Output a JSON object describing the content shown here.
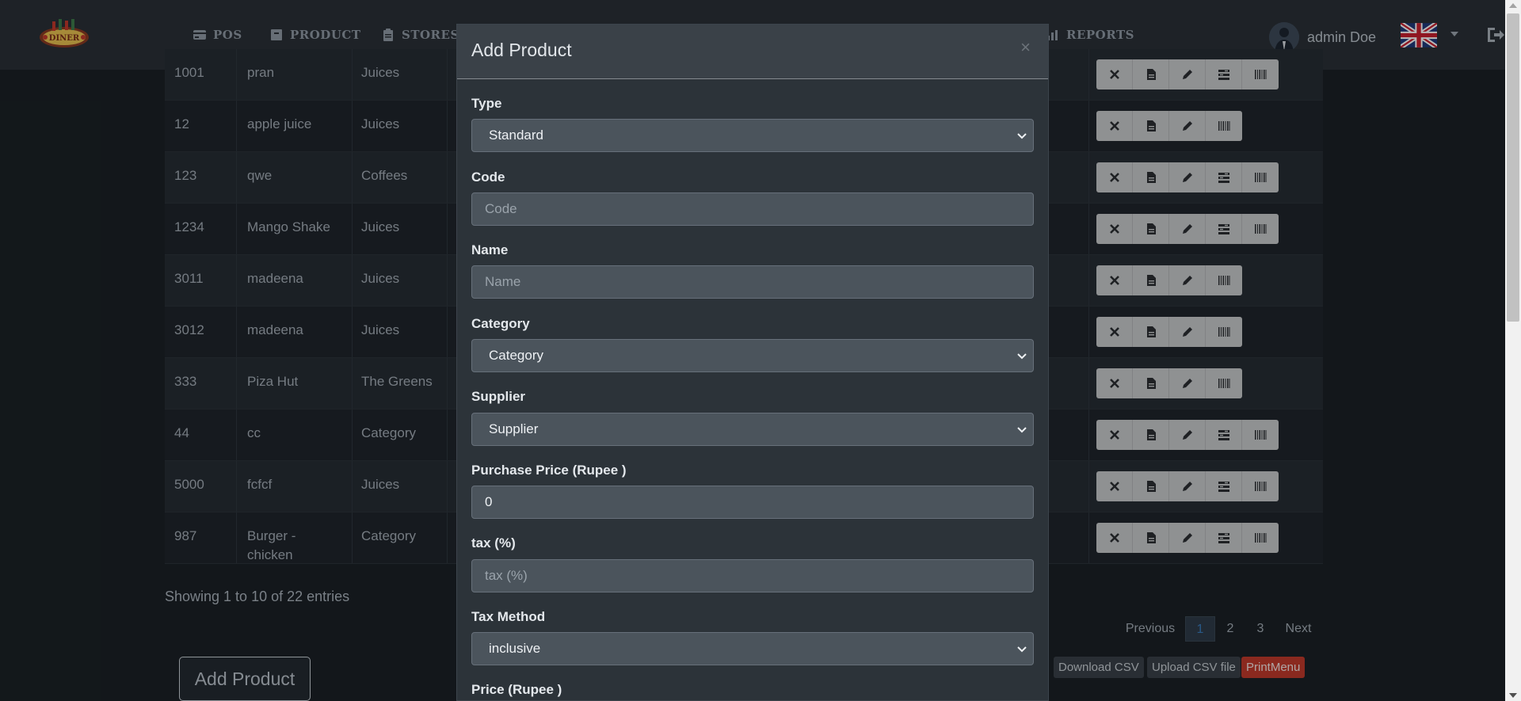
{
  "nav": {
    "items": [
      {
        "label": "POS",
        "icon": "credit-card-icon"
      },
      {
        "label": "PRODUCT",
        "icon": "archive-icon"
      },
      {
        "label": "STORES",
        "icon": "clipboard-icon"
      },
      {
        "label": "REPORTS",
        "icon": "chart-icon"
      }
    ],
    "user_name": "admin Doe",
    "logo_text": "DINER"
  },
  "table": {
    "rows": [
      {
        "code": "1001",
        "name": "pran",
        "category": "Juices",
        "actions": 5
      },
      {
        "code": "12",
        "name": "apple juice",
        "category": "Juices",
        "actions": 4
      },
      {
        "code": "123",
        "name": "qwe",
        "category": "Coffees",
        "actions": 5
      },
      {
        "code": "1234",
        "name": "Mango Shake",
        "category": "Juices",
        "actions": 5
      },
      {
        "code": "3011",
        "name": "madeena",
        "category": "Juices",
        "actions": 4
      },
      {
        "code": "3012",
        "name": "madeena",
        "category": "Juices",
        "actions": 4
      },
      {
        "code": "333",
        "name": "Piza Hut",
        "category": "The Greens",
        "actions": 4
      },
      {
        "code": "44",
        "name": "cc",
        "category": "Category",
        "actions": 5
      },
      {
        "code": "5000",
        "name": "fcfcf",
        "category": "Juices",
        "actions": 5
      },
      {
        "code": "987",
        "name": "Burger -\nchicken",
        "category": "Category",
        "actions": 5
      }
    ],
    "entries_text": "Showing 1 to 10 of 22 entries"
  },
  "pagination": {
    "previous": "Previous",
    "pages": [
      "1",
      "2",
      "3"
    ],
    "active_page": "1",
    "next": "Next"
  },
  "footer": {
    "add_product": "Add Product",
    "download_csv": "Download CSV",
    "upload_csv": "Upload CSV file",
    "print_menu": "PrintMenu"
  },
  "modal": {
    "title": "Add Product",
    "close": "×",
    "fields": {
      "type": {
        "label": "Type",
        "value": "Standard"
      },
      "code": {
        "label": "Code",
        "placeholder": "Code"
      },
      "name": {
        "label": "Name",
        "placeholder": "Name"
      },
      "category": {
        "label": "Category",
        "value": "Category"
      },
      "supplier": {
        "label": "Supplier",
        "value": "Supplier"
      },
      "purchase_price": {
        "label": "Purchase Price (Rupee )",
        "value": "0"
      },
      "tax": {
        "label": "tax (%)",
        "placeholder": "tax (%)"
      },
      "tax_method": {
        "label": "Tax Method",
        "value": "inclusive"
      },
      "price": {
        "label": "Price (Rupee )"
      }
    }
  },
  "colors": {
    "navbar": "#2a3036",
    "modal": "#2c3339",
    "print_menu": "#c0392b",
    "active_page": "#3a7cbd"
  }
}
